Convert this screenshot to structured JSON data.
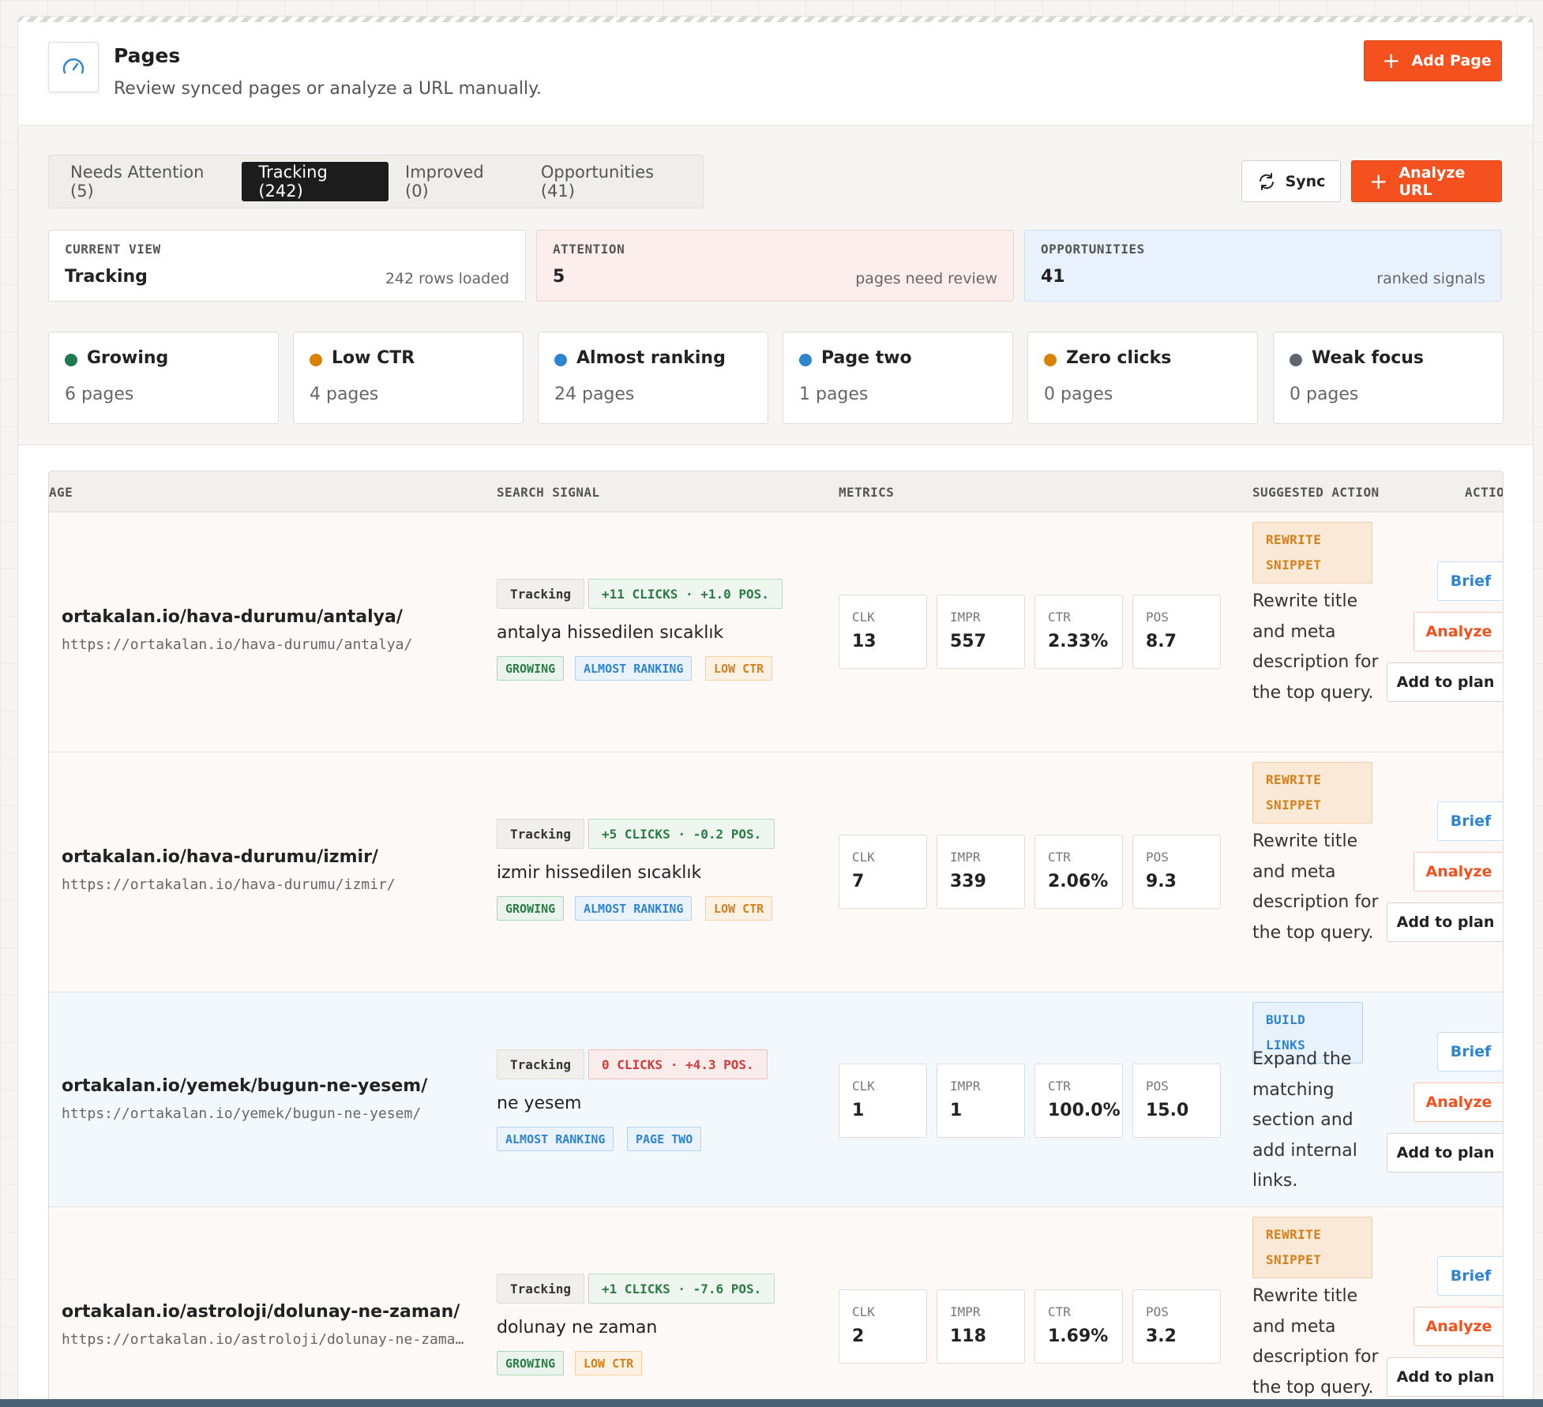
{
  "header": {
    "title": "Pages",
    "subtitle": "Review synced pages or analyze a URL manually.",
    "add_page_label": "Add Page"
  },
  "tabs": [
    {
      "label": "Needs Attention (5)",
      "active": false
    },
    {
      "label": "Tracking (242)",
      "active": true
    },
    {
      "label": "Improved (0)",
      "active": false
    },
    {
      "label": "Opportunities (41)",
      "active": false
    }
  ],
  "toolbar": {
    "sync_label": "Sync",
    "analyze_label": "Analyze URL"
  },
  "summary": {
    "current": {
      "label": "CURRENT VIEW",
      "value": "Tracking",
      "note": "242 rows loaded"
    },
    "attention": {
      "label": "ATTENTION",
      "value": "5",
      "note": "pages need review"
    },
    "opportunities": {
      "label": "OPPORTUNITIES",
      "value": "41",
      "note": "ranked signals"
    }
  },
  "signals": [
    {
      "name": "Growing",
      "count": "6 pages",
      "color": "#1f7a4d"
    },
    {
      "name": "Low CTR",
      "count": "4 pages",
      "color": "#d98200"
    },
    {
      "name": "Almost ranking",
      "count": "24 pages",
      "color": "#2f84d0"
    },
    {
      "name": "Page two",
      "count": "1 pages",
      "color": "#2f84d0"
    },
    {
      "name": "Zero clicks",
      "count": "0 pages",
      "color": "#d98200"
    },
    {
      "name": "Weak focus",
      "count": "0 pages",
      "color": "#5f6670"
    }
  ],
  "table": {
    "headers": [
      "AGE",
      "SEARCH SIGNAL",
      "METRICS",
      "SUGGESTED ACTION",
      "ACTIONS"
    ],
    "metric_labels": [
      "CLK",
      "IMPR",
      "CTR",
      "POS"
    ],
    "buttons": {
      "brief": "Brief",
      "analyze": "Analyze",
      "plan": "Add to plan"
    },
    "rows": [
      {
        "title": "ortakalan.io/hava-durumu/antalya/",
        "url": "https://ortakalan.io/hava-durumu/antalya/",
        "status": "Tracking",
        "delta": "+11 CLICKS · +1.0 POS.",
        "delta_type": "pos",
        "query": "antalya hissedilen sıcaklık",
        "tags": [
          {
            "label": "GROWING",
            "type": "g"
          },
          {
            "label": "ALMOST RANKING",
            "type": "b"
          },
          {
            "label": "LOW CTR",
            "type": "o"
          }
        ],
        "metrics": [
          "13",
          "557",
          "2.33%",
          "8.7"
        ],
        "action_tag": "REWRITE SNIPPET",
        "action_type": "o",
        "action_text": "Rewrite title and meta description for the top query.",
        "bg": "#fcf9f6"
      },
      {
        "title": "ortakalan.io/hava-durumu/izmir/",
        "url": "https://ortakalan.io/hava-durumu/izmir/",
        "status": "Tracking",
        "delta": "+5 CLICKS · -0.2 POS.",
        "delta_type": "pos",
        "query": "izmir hissedilen sıcaklık",
        "tags": [
          {
            "label": "GROWING",
            "type": "g"
          },
          {
            "label": "ALMOST RANKING",
            "type": "b"
          },
          {
            "label": "LOW CTR",
            "type": "o"
          }
        ],
        "metrics": [
          "7",
          "339",
          "2.06%",
          "9.3"
        ],
        "action_tag": "REWRITE SNIPPET",
        "action_type": "o",
        "action_text": "Rewrite title and meta description for the top query.",
        "bg": "#fcf9f6"
      },
      {
        "title": "ortakalan.io/yemek/bugun-ne-yesem/",
        "url": "https://ortakalan.io/yemek/bugun-ne-yesem/",
        "status": "Tracking",
        "delta": "0 CLICKS · +4.3 POS.",
        "delta_type": "neg",
        "query": "ne yesem",
        "tags": [
          {
            "label": "ALMOST RANKING",
            "type": "b"
          },
          {
            "label": "PAGE TWO",
            "type": "b"
          }
        ],
        "metrics": [
          "1",
          "1",
          "100.0%",
          "15.0"
        ],
        "action_tag": "BUILD LINKS",
        "action_type": "b",
        "action_text": "Expand the matching section and add internal links.",
        "bg": "#f3f8fc"
      },
      {
        "title": "ortakalan.io/astroloji/dolunay-ne-zaman/",
        "url": "https://ortakalan.io/astroloji/dolunay-ne-zaman/",
        "status": "Tracking",
        "delta": "+1 CLICKS · -7.6 POS.",
        "delta_type": "pos",
        "query": "dolunay ne zaman",
        "tags": [
          {
            "label": "GROWING",
            "type": "g"
          },
          {
            "label": "LOW CTR",
            "type": "o"
          }
        ],
        "metrics": [
          "2",
          "118",
          "1.69%",
          "3.2"
        ],
        "action_tag": "REWRITE SNIPPET",
        "action_type": "o",
        "action_text": "Rewrite title and meta description for the top query.",
        "bg": "#fcf9f6"
      }
    ]
  }
}
